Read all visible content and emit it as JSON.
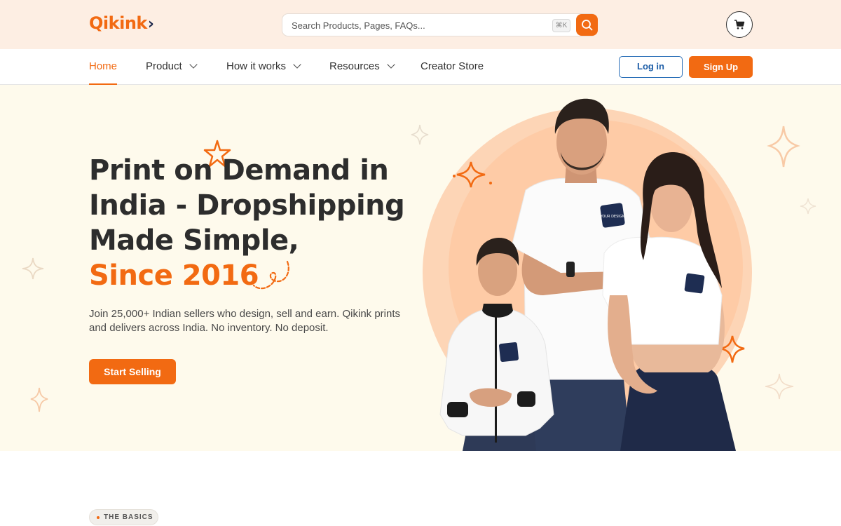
{
  "brand": {
    "name": "Qikink",
    "accent": "#f26a12",
    "dark": "#1f2a4d"
  },
  "search": {
    "placeholder": "Search Products, Pages, FAQs...",
    "shortcut": "⌘K",
    "icon": "search-icon"
  },
  "cart": {
    "icon": "cart-icon"
  },
  "nav": {
    "items": [
      {
        "label": "Home",
        "active": true
      },
      {
        "label": "Product",
        "dropdown": true
      },
      {
        "label": "How it works",
        "dropdown": true
      },
      {
        "label": "Resources",
        "dropdown": true
      },
      {
        "label": "Creator Store",
        "dropdown": false
      }
    ],
    "login": "Log in",
    "signup": "Sign Up"
  },
  "hero": {
    "headline_lines": [
      "Print on Demand in",
      "India - Dropshipping",
      "Made Simple,"
    ],
    "headline_accent": "Since 2016",
    "subtext": "Join 25,000+ Indian sellers who design, sell and earn. Qikink prints and delivers across India. No inventory. No deposit.",
    "cta": "Start Selling",
    "print_patch_text": "YOUR DESIGN HERE"
  },
  "section": {
    "badge": "THE BASICS"
  }
}
